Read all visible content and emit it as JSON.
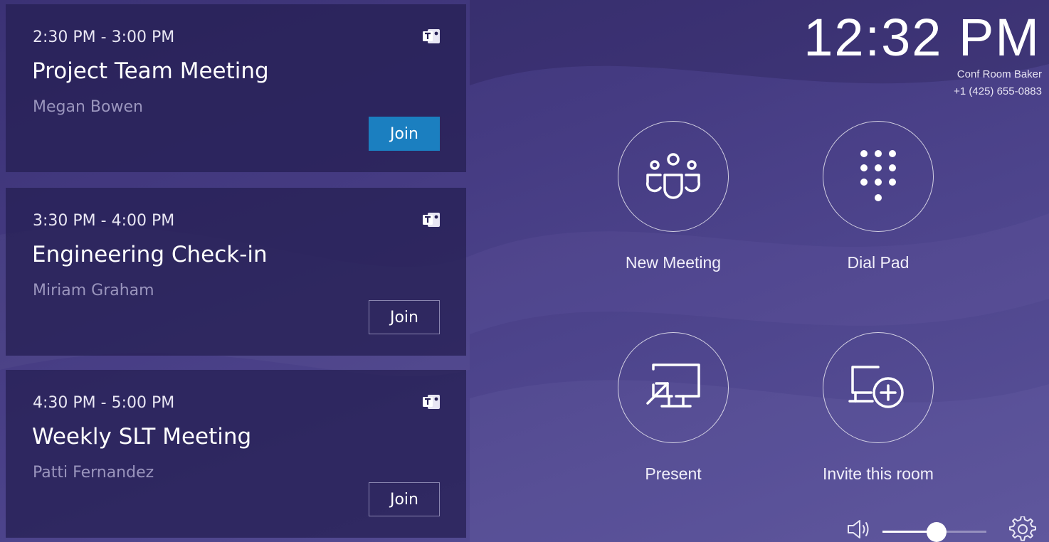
{
  "meetings": [
    {
      "time": "2:30 PM - 3:00 PM",
      "title": "Project Team Meeting",
      "organizer": "Megan Bowen",
      "join_label": "Join",
      "join_style": "primary"
    },
    {
      "time": "3:30 PM - 4:00 PM",
      "title": "Engineering Check-in",
      "organizer": "Miriam Graham",
      "join_label": "Join",
      "join_style": "outline"
    },
    {
      "time": "4:30 PM - 5:00 PM",
      "title": "Weekly SLT Meeting",
      "organizer": "Patti Fernandez",
      "join_label": "Join",
      "join_style": "outline"
    }
  ],
  "header": {
    "clock": "12:32 PM",
    "room_name": "Conf Room Baker",
    "room_phone": "+1 (425) 655-0883"
  },
  "actions": [
    {
      "label": "New Meeting",
      "icon": "teams-people-icon"
    },
    {
      "label": "Dial Pad",
      "icon": "dial-pad-icon"
    },
    {
      "label": "Present",
      "icon": "present-screen-icon"
    },
    {
      "label": "Invite this room",
      "icon": "invite-room-icon"
    }
  ],
  "volume": {
    "level": 0.52,
    "icon": "speaker-icon"
  },
  "settings": {
    "icon": "gear-icon"
  },
  "colors": {
    "accent": "#1b7fc0",
    "background": "#453b82",
    "card": "#262054"
  }
}
